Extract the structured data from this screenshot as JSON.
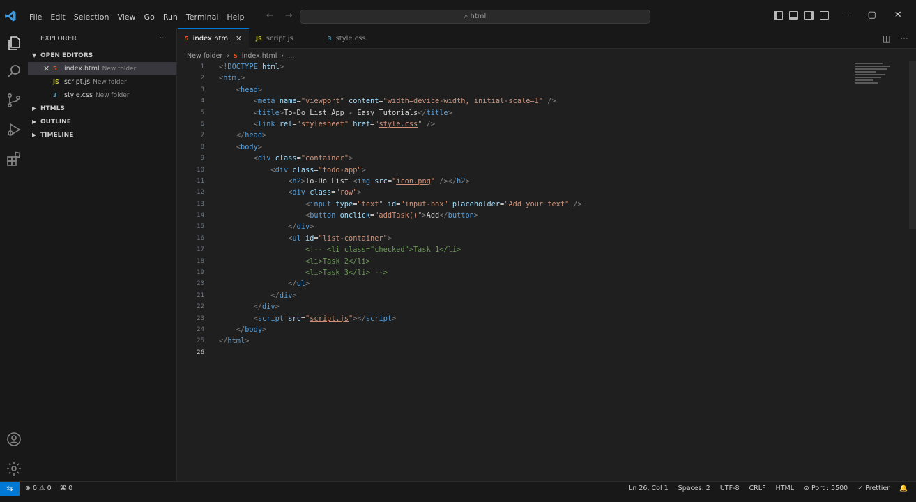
{
  "titlebar": {
    "menu": [
      "File",
      "Edit",
      "Selection",
      "View",
      "Go",
      "Run",
      "Terminal",
      "Help"
    ],
    "search_placeholder": "html"
  },
  "sidebar": {
    "title": "EXPLORER",
    "more": "···",
    "open_editors_label": "OPEN EDITORS",
    "open_editors": [
      {
        "icon": "html-file-icon",
        "icon_text": "5",
        "icon_color": "#e44d26",
        "name": "index.html",
        "folder": "New folder",
        "selected": true
      },
      {
        "icon": "js-file-icon",
        "icon_text": "JS",
        "icon_color": "#cbcb41",
        "name": "script.js",
        "folder": "New folder",
        "selected": false
      },
      {
        "icon": "css-file-icon",
        "icon_text": "3",
        "icon_color": "#519aba",
        "name": "style.css",
        "folder": "New folder",
        "selected": false
      }
    ],
    "sections": [
      "HTMLS",
      "OUTLINE",
      "TIMELINE"
    ]
  },
  "tabs": [
    {
      "name": "index.html",
      "icon_text": "5",
      "icon_color": "#e44d26",
      "active": true
    },
    {
      "name": "script.js",
      "icon_text": "JS",
      "icon_color": "#cbcb41",
      "active": false
    },
    {
      "name": "style.css",
      "icon_text": "3",
      "icon_color": "#519aba",
      "active": false
    }
  ],
  "breadcrumb": {
    "folder": "New folder",
    "file": "index.html",
    "tail": "..."
  },
  "code": {
    "current_line": 26,
    "lines": [
      [
        [
          "punc",
          "<!"
        ],
        [
          "tag",
          "DOCTYPE "
        ],
        [
          "attr",
          "html"
        ],
        [
          "punc",
          ">"
        ]
      ],
      [
        [
          "punc",
          "<"
        ],
        [
          "tag",
          "html"
        ],
        [
          "punc",
          ">"
        ]
      ],
      [
        [
          "txt",
          "    "
        ],
        [
          "punc",
          "<"
        ],
        [
          "tag",
          "head"
        ],
        [
          "punc",
          ">"
        ]
      ],
      [
        [
          "txt",
          "        "
        ],
        [
          "punc",
          "<"
        ],
        [
          "tag",
          "meta "
        ],
        [
          "attr",
          "name"
        ],
        [
          "txt",
          "="
        ],
        [
          "str",
          "\"viewport\" "
        ],
        [
          "attr",
          "content"
        ],
        [
          "txt",
          "="
        ],
        [
          "str",
          "\"width=device-width, initial-scale=1\""
        ],
        [
          "punc",
          " />"
        ]
      ],
      [
        [
          "txt",
          "        "
        ],
        [
          "punc",
          "<"
        ],
        [
          "tag",
          "title"
        ],
        [
          "punc",
          ">"
        ],
        [
          "txt",
          "To-Do List App - Easy Tutorials"
        ],
        [
          "punc",
          "</"
        ],
        [
          "tag",
          "title"
        ],
        [
          "punc",
          ">"
        ]
      ],
      [
        [
          "txt",
          "        "
        ],
        [
          "punc",
          "<"
        ],
        [
          "tag",
          "link "
        ],
        [
          "attr",
          "rel"
        ],
        [
          "txt",
          "="
        ],
        [
          "str",
          "\"stylesheet\" "
        ],
        [
          "attr",
          "href"
        ],
        [
          "txt",
          "="
        ],
        [
          "str",
          "\""
        ],
        [
          "strlink",
          "style.css"
        ],
        [
          "str",
          "\""
        ],
        [
          "punc",
          " />"
        ]
      ],
      [
        [
          "txt",
          "    "
        ],
        [
          "punc",
          "</"
        ],
        [
          "tag",
          "head"
        ],
        [
          "punc",
          ">"
        ]
      ],
      [
        [
          "txt",
          "    "
        ],
        [
          "punc",
          "<"
        ],
        [
          "tag",
          "body"
        ],
        [
          "punc",
          ">"
        ]
      ],
      [
        [
          "txt",
          "        "
        ],
        [
          "punc",
          "<"
        ],
        [
          "tag",
          "div "
        ],
        [
          "attr",
          "class"
        ],
        [
          "txt",
          "="
        ],
        [
          "str",
          "\"container\""
        ],
        [
          "punc",
          ">"
        ]
      ],
      [
        [
          "txt",
          "            "
        ],
        [
          "punc",
          "<"
        ],
        [
          "tag",
          "div "
        ],
        [
          "attr",
          "class"
        ],
        [
          "txt",
          "="
        ],
        [
          "str",
          "\"todo-app\""
        ],
        [
          "punc",
          ">"
        ]
      ],
      [
        [
          "txt",
          "                "
        ],
        [
          "punc",
          "<"
        ],
        [
          "tag",
          "h2"
        ],
        [
          "punc",
          ">"
        ],
        [
          "txt",
          "To-Do List "
        ],
        [
          "punc",
          "<"
        ],
        [
          "tag",
          "img "
        ],
        [
          "attr",
          "src"
        ],
        [
          "txt",
          "="
        ],
        [
          "str",
          "\""
        ],
        [
          "strlink",
          "icon.png"
        ],
        [
          "str",
          "\""
        ],
        [
          "punc",
          " /></"
        ],
        [
          "tag",
          "h2"
        ],
        [
          "punc",
          ">"
        ]
      ],
      [
        [
          "txt",
          "                "
        ],
        [
          "punc",
          "<"
        ],
        [
          "tag",
          "div "
        ],
        [
          "attr",
          "class"
        ],
        [
          "txt",
          "="
        ],
        [
          "str",
          "\"row\""
        ],
        [
          "punc",
          ">"
        ]
      ],
      [
        [
          "txt",
          "                    "
        ],
        [
          "punc",
          "<"
        ],
        [
          "tag",
          "input "
        ],
        [
          "attr",
          "type"
        ],
        [
          "txt",
          "="
        ],
        [
          "str",
          "\"text\" "
        ],
        [
          "attr",
          "id"
        ],
        [
          "txt",
          "="
        ],
        [
          "str",
          "\"input-box\" "
        ],
        [
          "attr",
          "placeholder"
        ],
        [
          "txt",
          "="
        ],
        [
          "str",
          "\"Add your text\""
        ],
        [
          "punc",
          " />"
        ]
      ],
      [
        [
          "txt",
          "                    "
        ],
        [
          "punc",
          "<"
        ],
        [
          "tag",
          "button "
        ],
        [
          "attr",
          "onclick"
        ],
        [
          "txt",
          "="
        ],
        [
          "str",
          "\"addTask()\""
        ],
        [
          "punc",
          ">"
        ],
        [
          "txt",
          "Add"
        ],
        [
          "punc",
          "</"
        ],
        [
          "tag",
          "button"
        ],
        [
          "punc",
          ">"
        ]
      ],
      [
        [
          "txt",
          "                "
        ],
        [
          "punc",
          "</"
        ],
        [
          "tag",
          "div"
        ],
        [
          "punc",
          ">"
        ]
      ],
      [
        [
          "txt",
          "                "
        ],
        [
          "punc",
          "<"
        ],
        [
          "tag",
          "ul "
        ],
        [
          "attr",
          "id"
        ],
        [
          "txt",
          "="
        ],
        [
          "str",
          "\"list-container\""
        ],
        [
          "punc",
          ">"
        ]
      ],
      [
        [
          "txt",
          "                    "
        ],
        [
          "com",
          "<!-- <li class=\"checked\">Task 1</li>"
        ]
      ],
      [
        [
          "txt",
          "                    "
        ],
        [
          "com",
          "<li>Task 2</li>"
        ]
      ],
      [
        [
          "txt",
          "                    "
        ],
        [
          "com",
          "<li>Task 3</li> -->"
        ]
      ],
      [
        [
          "txt",
          "                "
        ],
        [
          "punc",
          "</"
        ],
        [
          "tag",
          "ul"
        ],
        [
          "punc",
          ">"
        ]
      ],
      [
        [
          "txt",
          "            "
        ],
        [
          "punc",
          "</"
        ],
        [
          "tag",
          "div"
        ],
        [
          "punc",
          ">"
        ]
      ],
      [
        [
          "txt",
          "        "
        ],
        [
          "punc",
          "</"
        ],
        [
          "tag",
          "div"
        ],
        [
          "punc",
          ">"
        ]
      ],
      [
        [
          "txt",
          "        "
        ],
        [
          "punc",
          "<"
        ],
        [
          "tag",
          "script "
        ],
        [
          "attr",
          "src"
        ],
        [
          "txt",
          "="
        ],
        [
          "str",
          "\""
        ],
        [
          "strlink",
          "script.js"
        ],
        [
          "str",
          "\""
        ],
        [
          "punc",
          "></"
        ],
        [
          "tag",
          "script"
        ],
        [
          "punc",
          ">"
        ]
      ],
      [
        [
          "txt",
          "    "
        ],
        [
          "punc",
          "</"
        ],
        [
          "tag",
          "body"
        ],
        [
          "punc",
          ">"
        ]
      ],
      [
        [
          "punc",
          "</"
        ],
        [
          "tag",
          "html"
        ],
        [
          "punc",
          ">"
        ]
      ],
      []
    ]
  },
  "statusbar": {
    "remote": "⇆",
    "problems": "⊗ 0  ⚠ 0",
    "ports": "⌘ 0",
    "position": "Ln 26, Col 1",
    "spaces": "Spaces: 2",
    "encoding": "UTF-8",
    "eol": "CRLF",
    "language": "HTML",
    "port": "⊘ Port : 5500",
    "prettier": "✓ Prettier",
    "bell": "🔔"
  },
  "colors": {
    "accent": "#0078d4",
    "background": "#1f1f1f",
    "sidebar": "#181818"
  }
}
